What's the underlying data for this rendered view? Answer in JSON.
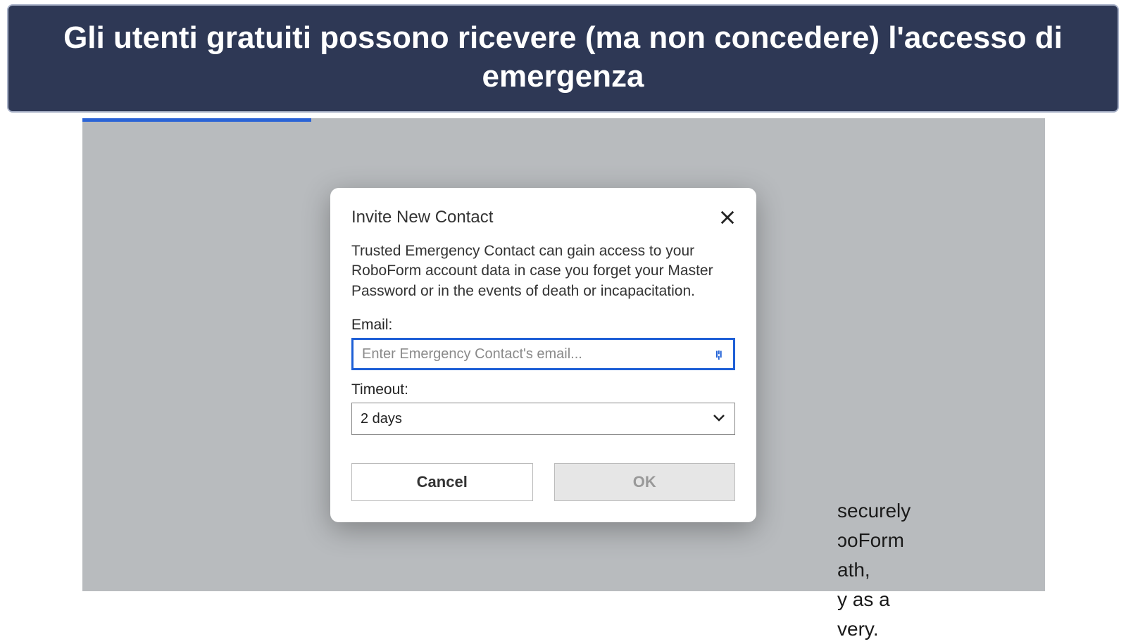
{
  "caption": "Gli utenti gratuiti possono ricevere (ma non concedere) l'accesso di emergenza",
  "background_text": {
    "line1": "securely",
    "line2": "ɔoForm",
    "line3": "ath,",
    "line4": "y as a",
    "line5": "very."
  },
  "dialog": {
    "title": "Invite New Contact",
    "description": "Trusted Emergency Contact can gain access to your RoboForm account data in case you forget your Master Password or in the events of death or incapacitation.",
    "email_label": "Email:",
    "email_placeholder": "Enter Emergency Contact's email...",
    "email_value": "",
    "timeout_label": "Timeout:",
    "timeout_value": "2 days",
    "cancel_label": "Cancel",
    "ok_label": "OK"
  }
}
